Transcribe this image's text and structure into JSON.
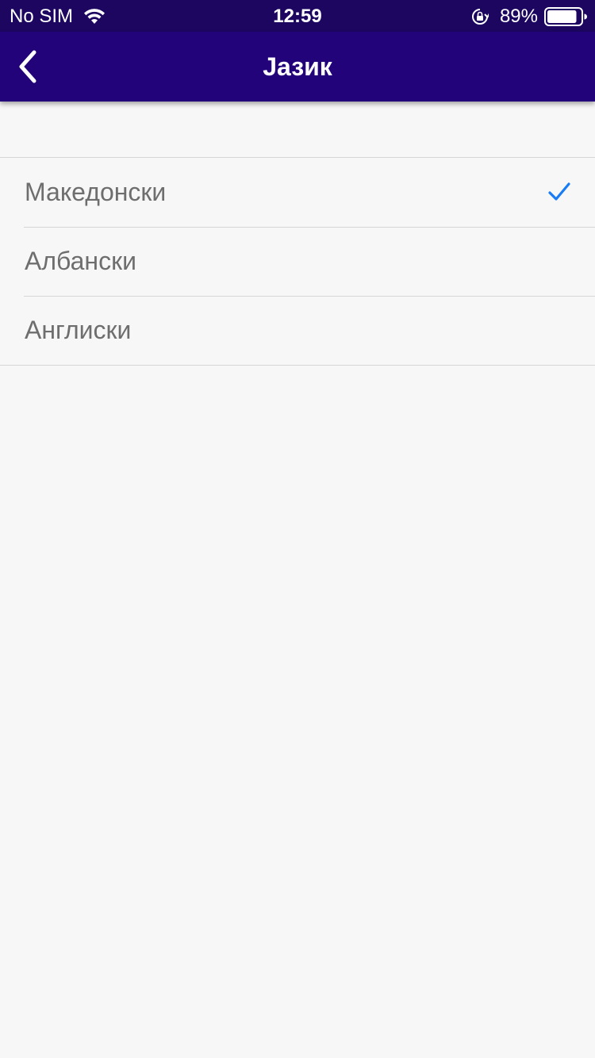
{
  "status_bar": {
    "carrier": "No SIM",
    "time": "12:59",
    "battery_percent": "89%",
    "battery_level": 0.89,
    "icons": [
      "wifi-icon",
      "orientation-lock-icon",
      "battery-icon"
    ]
  },
  "nav": {
    "title": "Јазик",
    "back_icon": "chevron-left-icon"
  },
  "languages": [
    {
      "label": "Македонски",
      "selected": true
    },
    {
      "label": "Албански",
      "selected": false
    },
    {
      "label": "Англиски",
      "selected": false
    }
  ],
  "colors": {
    "status_bar_bg": "#1c0660",
    "nav_bar_bg": "#22037a",
    "checkmark": "#1a7cf5",
    "background": "#f7f7f7"
  }
}
